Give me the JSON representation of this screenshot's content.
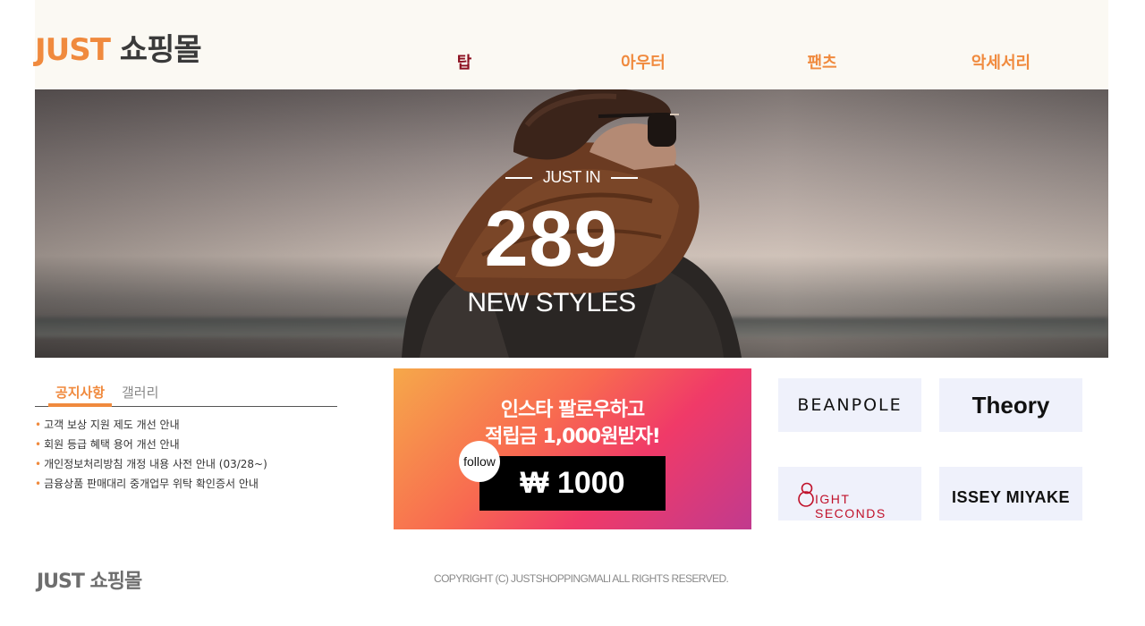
{
  "header": {
    "logo_brand": "JUST",
    "logo_mall": "쇼핑몰",
    "nav": [
      {
        "label": "탑",
        "active": true
      },
      {
        "label": "아우터",
        "active": false
      },
      {
        "label": "팬츠",
        "active": false
      },
      {
        "label": "악세서리",
        "active": false
      }
    ]
  },
  "hero": {
    "subtitle": "JUST IN",
    "number": "289",
    "title": "NEW STYLES"
  },
  "notice": {
    "tabs": [
      "공지사항",
      "갤러리"
    ],
    "bullet": "•",
    "items": [
      "고객 보상 지원 제도 개선 안내",
      "회원 등급 혜택 용어 개선 안내",
      "개인정보처리방침 개정 내용 사전 안내 (03/28~)",
      "금융상품 판매대리 중개업무 위탁 확인증서 안내"
    ]
  },
  "banner": {
    "line1": "인스타 팔로우하고",
    "line2": "적립금 1,000원받자!",
    "follow": "follow",
    "price": "₩ 1000"
  },
  "brands": [
    "BEANPOLE",
    "Theory",
    "IGHT SECONDS",
    "ISSEY MIYAKE"
  ],
  "footer": {
    "logo": "JUST 쇼핑몰",
    "copyright": "COPYRIGHT (C) JUSTSHOPPINGMALl ALL RIGHTS RESERVED."
  },
  "colors": {
    "accent": "#f08a3e",
    "active_nav": "#8c1020",
    "brand_box_bg": "#eff1fb",
    "header_bg": "#fbf9f3"
  }
}
